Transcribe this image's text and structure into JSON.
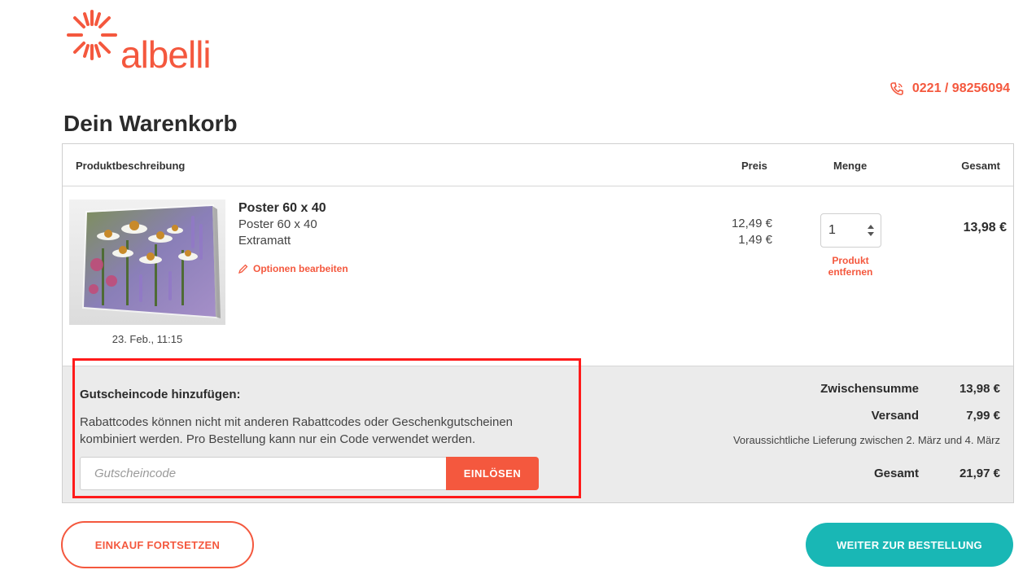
{
  "brand": {
    "name": "albelli",
    "color": "#f4583e",
    "logo_icon": "starburst-icon"
  },
  "header": {
    "phone": "0221 / 98256094",
    "phone_icon": "phone-icon"
  },
  "page": {
    "title": "Dein Warenkorb"
  },
  "table": {
    "headers": {
      "description": "Produktbeschreibung",
      "price": "Preis",
      "quantity": "Menge",
      "total": "Gesamt"
    }
  },
  "item": {
    "name": "Poster 60 x 40",
    "lines": [
      "Poster 60 x 40",
      "Extramatt"
    ],
    "prices": [
      "12,49 €",
      "1,49 €"
    ],
    "date": "23. Feb., 11:15",
    "edit_label": "Optionen bearbeiten",
    "quantity": "1",
    "remove_label": "Produkt entfernen",
    "line_total": "13,98 €"
  },
  "coupon": {
    "title": "Gutscheincode hinzufügen:",
    "text": "Rabattcodes können nicht mit anderen Rabattcodes oder Geschenkgutscheinen kombiniert werden. Pro Bestellung kann nur ein Code verwendet werden.",
    "placeholder": "Gutscheincode",
    "button": "EINLÖSEN"
  },
  "summary": {
    "subtotal_label": "Zwischensumme",
    "subtotal": "13,98 €",
    "shipping_label": "Versand",
    "shipping": "7,99 €",
    "delivery": "Voraussichtliche Lieferung zwischen 2. März und 4. März",
    "total_label": "Gesamt",
    "total": "21,97 €"
  },
  "actions": {
    "continue_shopping": "EINKAUF FORTSETZEN",
    "checkout": "WEITER ZUR BESTELLUNG"
  },
  "colors": {
    "accent": "#f4583e",
    "checkout": "#19b7b5",
    "highlight": "#ff1a1a",
    "summary_bg": "#ebebeb"
  }
}
